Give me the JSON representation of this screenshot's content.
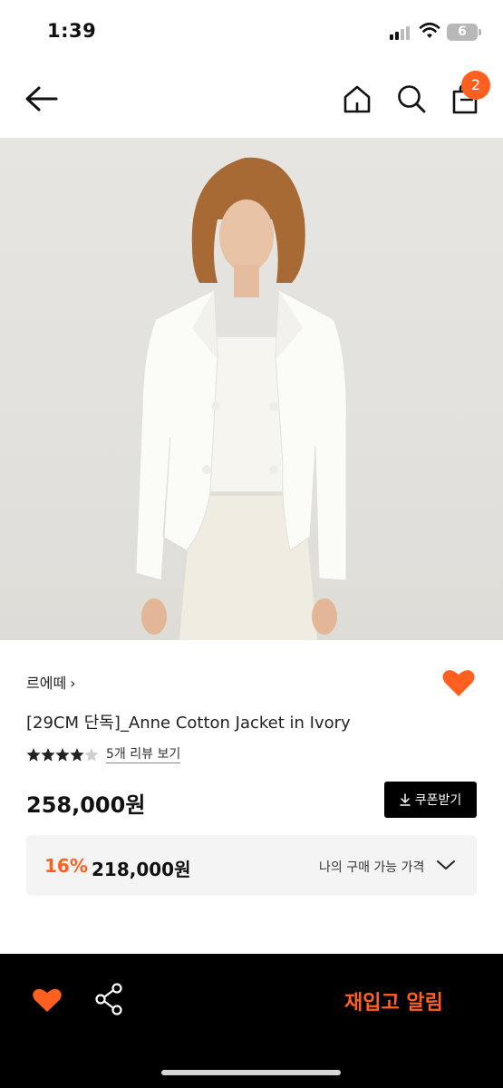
{
  "status_bar": {
    "time": "1:39",
    "battery_level": "6",
    "icons": [
      "signal-icon",
      "wifi-icon",
      "battery-icon"
    ]
  },
  "header": {
    "icons": [
      "back-arrow-icon",
      "home-icon",
      "search-icon",
      "shopping-bag-icon"
    ],
    "cart_count": "2"
  },
  "product": {
    "brand": "르에떼",
    "brand_chevron": "›",
    "title": "[29CM 단독]_Anne Cotton Jacket in Ivory",
    "rating": 4.5,
    "review_link": "5개 리뷰 보기",
    "price": "258,000원",
    "coupon_button": "쿠폰받기",
    "discount_rate": "16%",
    "discounted_price": "218,000원",
    "my_price_label": "나의 구매 가능 가격",
    "liked": true
  },
  "bottom_bar": {
    "restock_button": "재입고 알림",
    "icons": [
      "heart-icon",
      "share-icon"
    ]
  },
  "colors": {
    "accent": "#ff5f1f",
    "black": "#000000",
    "discount_box_bg": "#f4f4f4"
  }
}
